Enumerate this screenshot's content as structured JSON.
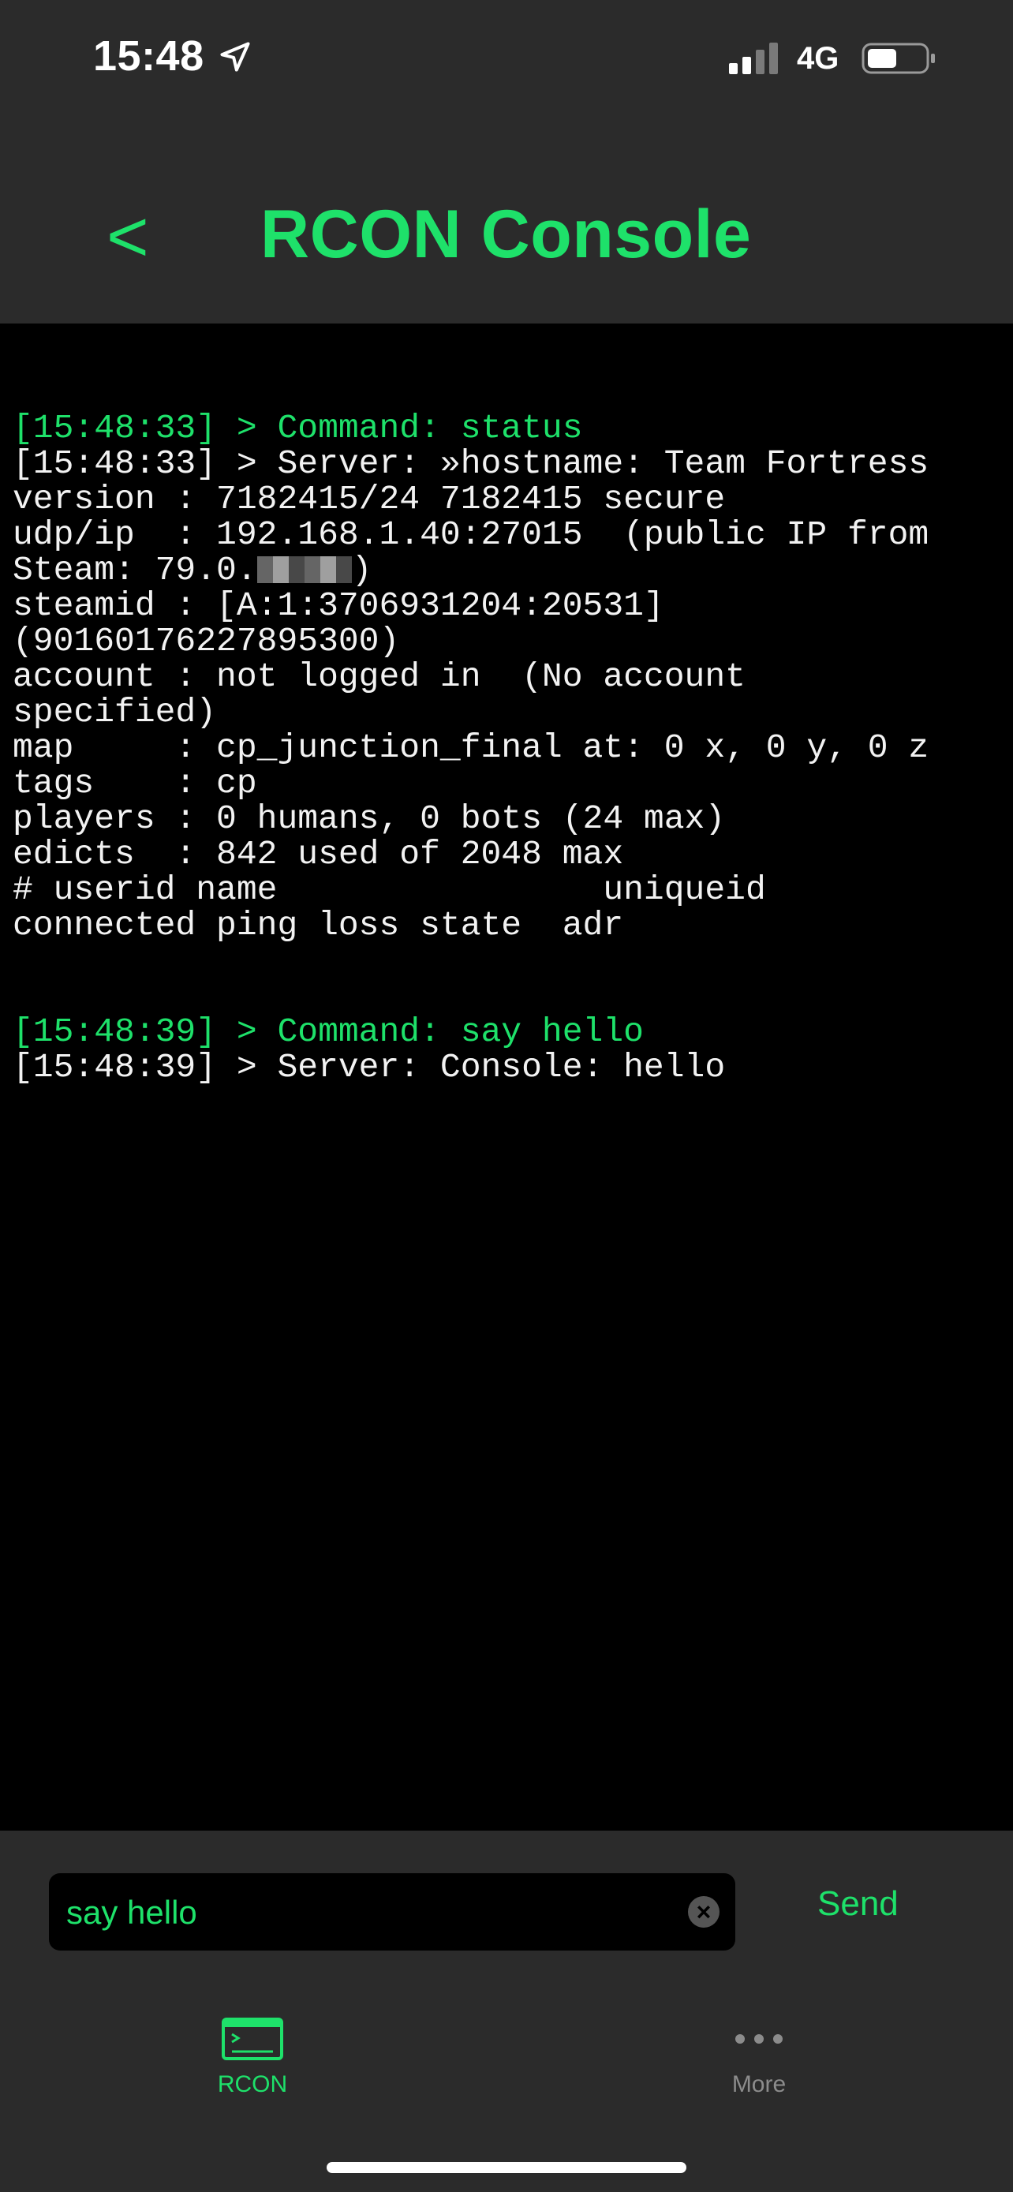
{
  "status_bar": {
    "time": "15:48",
    "network": "4G"
  },
  "nav": {
    "back_label": "<",
    "title": "RCON Console"
  },
  "console": {
    "lines": [
      {
        "text": "[15:48:33] > Command: status",
        "kind": "cmd"
      },
      {
        "text": "[15:48:33] > Server: »hostname: Team Fortress",
        "kind": "out"
      },
      {
        "text": "version : 7182415/24 7182415 secure",
        "kind": "out"
      },
      {
        "text": "udp/ip  : 192.168.1.40:27015  (public IP from",
        "kind": "out"
      },
      {
        "text": "Steam: 79.0.",
        "kind": "redacted",
        "suffix": ")"
      },
      {
        "text": "steamid : [A:1:3706931204:20531]",
        "kind": "out"
      },
      {
        "text": "(90160176227895300)",
        "kind": "out"
      },
      {
        "text": "account : not logged in  (No account",
        "kind": "out"
      },
      {
        "text": "specified)",
        "kind": "out"
      },
      {
        "text": "map     : cp_junction_final at: 0 x, 0 y, 0 z",
        "kind": "out"
      },
      {
        "text": "tags    : cp",
        "kind": "out"
      },
      {
        "text": "players : 0 humans, 0 bots (24 max)",
        "kind": "out"
      },
      {
        "text": "edicts  : 842 used of 2048 max",
        "kind": "out"
      },
      {
        "text": "# userid name                uniqueid",
        "kind": "out"
      },
      {
        "text": "connected ping loss state  adr",
        "kind": "out"
      },
      {
        "text": "",
        "kind": "blank"
      },
      {
        "text": "",
        "kind": "blank"
      },
      {
        "text": "[15:48:39] > Command: say hello",
        "kind": "cmd"
      },
      {
        "text": "[15:48:39] > Server: Console: hello",
        "kind": "out"
      }
    ]
  },
  "input": {
    "value": "say hello",
    "send_label": "Send"
  },
  "tabs": [
    {
      "label": "RCON",
      "icon": "terminal-icon",
      "active": true
    },
    {
      "label": "More",
      "icon": "ellipsis-icon",
      "active": false
    }
  ],
  "colors": {
    "accent": "#1ee16a",
    "console_bg": "#000000",
    "chrome_bg": "#2b2b2b",
    "console_text": "#f2f2f2",
    "inactive_tab": "#8c8c8c"
  }
}
